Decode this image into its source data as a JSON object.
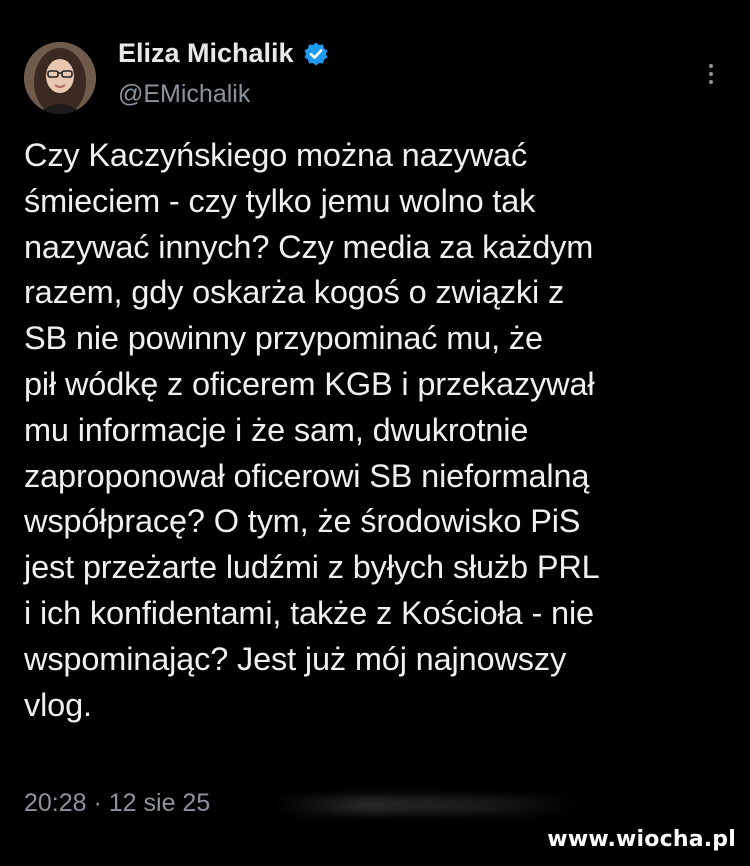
{
  "author": {
    "name": "Eliza Michalik",
    "handle": "@EMichalik",
    "verified_icon": "verified-badge-icon",
    "avatar_icon": "avatar-photo"
  },
  "more_icon": "more-vertical-icon",
  "tweet": {
    "lines": [
      "Czy Kaczyńskiego można nazywać",
      "śmieciem - czy tylko jemu wolno tak",
      "nazywać innych? Czy media za każdym",
      "razem, gdy oskarża kogoś o związki z",
      "SB nie powinny przypominać mu, że",
      "pił wódkę z oficerem KGB i przekazywał",
      "mu informacje i że sam, dwukrotnie",
      "zaproponował oficerowi SB nieformalną",
      "współpracę? O tym, że środowisko PiS",
      "jest przeżarte ludźmi z byłych służb PRL",
      "i ich konfidentami, także z Kościoła - nie",
      "wspominając? Jest już mój najnowszy",
      "vlog."
    ]
  },
  "timestamp": "20:28 · 12 sie 25",
  "watermark": "www.wiocha.pl",
  "colors": {
    "background": "#000000",
    "text": "#e7e9ea",
    "secondary": "#8b949c",
    "verified": "#1d9bf0"
  }
}
